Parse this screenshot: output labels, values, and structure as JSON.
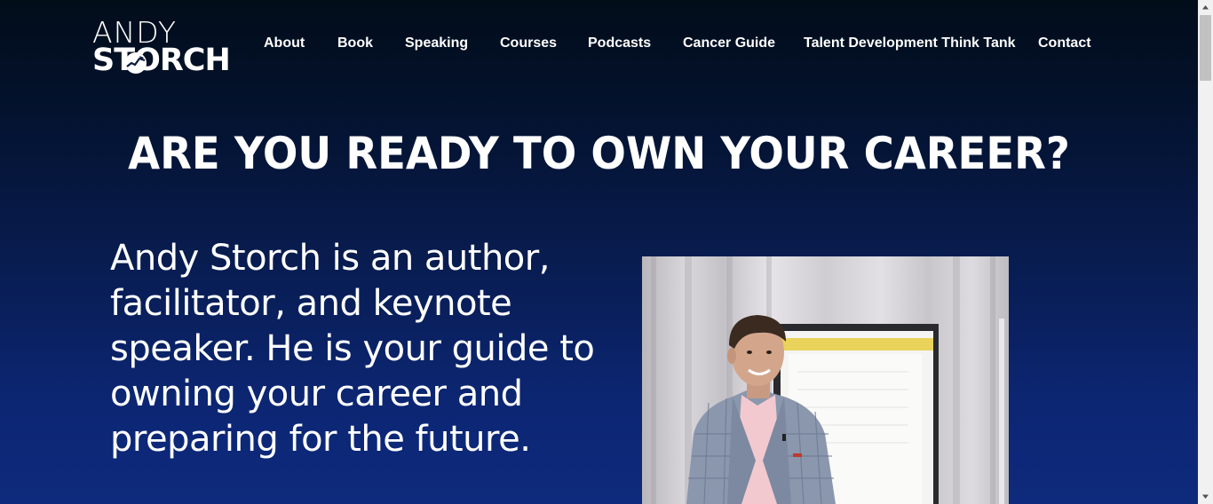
{
  "header": {
    "logo": {
      "line1": "ANDY",
      "line2": "STORCH"
    },
    "nav": [
      {
        "label": "About"
      },
      {
        "label": "Book"
      },
      {
        "label": "Speaking"
      },
      {
        "label": "Courses"
      },
      {
        "label": "Podcasts"
      },
      {
        "label": "Cancer Guide"
      },
      {
        "label": "Talent Development Think Tank"
      },
      {
        "label": "Contact"
      }
    ]
  },
  "hero": {
    "headline": "ARE YOU READY TO OWN YOUR CAREER?",
    "intro": "Andy Storch is an author, facilitator, and keynote speaker. He is your guide to owning your career and preparing for the future."
  },
  "colors": {
    "background_top": "#020d1a",
    "background_bottom": "#0e2a7c",
    "text": "#ffffff"
  }
}
